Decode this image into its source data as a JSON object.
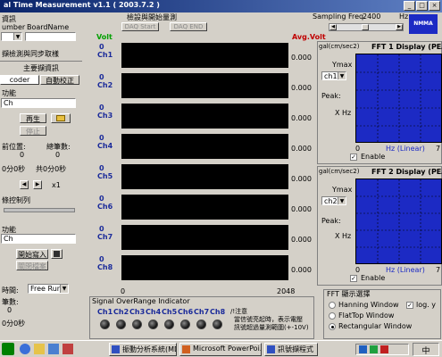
{
  "window": {
    "title": "al Time Measurement v1.1 ( 2003.7.2 )"
  },
  "left": {
    "group1_title": "資訊",
    "number_label": "umber",
    "boardname_label": "BoardName",
    "number_value": "",
    "boardname_value": "",
    "sync_text": "擷檢測與同步取樣",
    "main_title": "主要擷資訊",
    "tab_encoder": "coder",
    "tab_auto": "自動校正",
    "function_label": "功能",
    "function_value": "Ch",
    "play_button": "再生",
    "stop_button": "停止",
    "pos_label": "前位置:",
    "total_label": "總筆數:",
    "pos_value": "0",
    "total_value": "0",
    "time1_label": "0分0秒",
    "time2_label": "共0分0秒",
    "speed_label": "x1",
    "control_label": "條控制列",
    "function2_label": "功能",
    "function2_value": "Ch",
    "start_write_button": "開始寫入",
    "stop_write_button": "關閉檔案",
    "time_mode_label": "時間:",
    "time_mode_value": "Free Run",
    "records_label": "筆數:",
    "records_value": "0",
    "elapsed_label": "0分0秒"
  },
  "top": {
    "group_title": "檢設與開始量測",
    "daq_start": "DAQ Start",
    "daq_end": "DAQ END",
    "sampling_label": "Sampling Freq.",
    "sampling_value": "2400",
    "sampling_unit": "Hz"
  },
  "scope": {
    "volt_label": "Volt",
    "avg_label": "Avg.Volt",
    "channels": [
      {
        "name": "Ch1",
        "zero": "0",
        "avg": "0.000"
      },
      {
        "name": "Ch2",
        "zero": "0",
        "avg": "0.000"
      },
      {
        "name": "Ch3",
        "zero": "0",
        "avg": "0.000"
      },
      {
        "name": "Ch4",
        "zero": "0",
        "avg": "0.000"
      },
      {
        "name": "Ch5",
        "zero": "0",
        "avg": "0.000"
      },
      {
        "name": "Ch6",
        "zero": "0",
        "avg": "0.000"
      },
      {
        "name": "Ch7",
        "zero": "0",
        "avg": "0.000"
      },
      {
        "name": "Ch8",
        "zero": "0",
        "avg": "0.000"
      }
    ],
    "x_min": "0",
    "x_max": "2048"
  },
  "overrange": {
    "title": "Signal OverRange Indicator",
    "labels": [
      "Ch1",
      "Ch2",
      "Ch3",
      "Ch4",
      "Ch5",
      "Ch6",
      "Ch7",
      "Ch8"
    ],
    "note_title": "/!注意",
    "note_line1": "當信號亮起時，表示電壓",
    "note_line2": "訊號超過量測範圍(+-10V)"
  },
  "fft1": {
    "unit": "gal(cm/sec2)",
    "title": "FFT 1 Display (PEAK",
    "ymax_label": "Ymax",
    "channel": "ch1",
    "peak_label": "Peak:",
    "hz_label": "X Hz",
    "x_min": "0",
    "x_label": "Hz (Linear)",
    "x_max": "7",
    "enable_label": "Enable",
    "enabled": true
  },
  "fft2": {
    "unit": "gal(cm/sec2)",
    "title": "FFT 2 Display (PEAK",
    "ymax_label": "Ymax",
    "channel": "ch2",
    "peak_label": "Peak:",
    "hz_label": "X Hz",
    "x_min": "0",
    "x_label": "Hz (Linear)",
    "x_max": "7",
    "enable_label": "Enable",
    "enabled": true
  },
  "fft_options": {
    "title": "FFT 顯示選擇",
    "hanning": "Hanning Window",
    "flattop": "FlatTop Window",
    "rectangular": "Rectangular Window",
    "log_y": "log. y",
    "selected": "rectangular"
  },
  "taskbar": {
    "tasks": [
      "振動分析系統(MDI)",
      "Microsoft PowerPoi...",
      "訊號擷程式"
    ],
    "ime": "中"
  }
}
